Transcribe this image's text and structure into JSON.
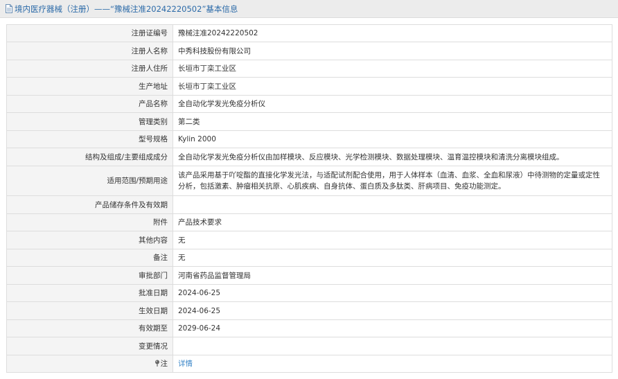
{
  "header": {
    "title": "境内医疗器械（注册）——“豫械注准20242220502”基本信息",
    "icon": "document-icon"
  },
  "rows": [
    {
      "key": "reg-number",
      "label": "注册证编号",
      "value": "豫械注准20242220502"
    },
    {
      "key": "registrant-name",
      "label": "注册人名称",
      "value": "中秀科技股份有限公司"
    },
    {
      "key": "registrant-address",
      "label": "注册人住所",
      "value": "长垣市丁栾工业区"
    },
    {
      "key": "production-address",
      "label": "生产地址",
      "value": "长垣市丁栾工业区"
    },
    {
      "key": "product-name",
      "label": "产品名称",
      "value": "全自动化学发光免疫分析仪"
    },
    {
      "key": "management-class",
      "label": "管理类别",
      "value": "第二类"
    },
    {
      "key": "model-spec",
      "label": "型号规格",
      "value": "Kylin 2000"
    },
    {
      "key": "structure-composition",
      "label": "结构及组成/主要组成成分",
      "value": "全自动化学发光免疫分析仪由加样模块、反应模块、光学检测模块、数据处理模块、温育温控模块和清洗分离模块组成。"
    },
    {
      "key": "intended-use",
      "label": "适用范围/预期用途",
      "value": "该产品采用基于吖啶酯的直接化学发光法，与适配试剂配合使用，用于人体样本（血清、血浆、全血和尿液）中待测物的定量或定性分析，包括激素、肿瘤相关抗原、心肌疾病、自身抗体、蛋白质及多肽类、肝病项目、免疫功能测定。"
    },
    {
      "key": "storage-conditions",
      "label": "产品储存条件及有效期",
      "value": ""
    },
    {
      "key": "attachment",
      "label": "附件",
      "value": "产品技术要求"
    },
    {
      "key": "other-content",
      "label": "其他内容",
      "value": "无"
    },
    {
      "key": "remarks",
      "label": "备注",
      "value": "无"
    },
    {
      "key": "approval-dept",
      "label": "审批部门",
      "value": "河南省药品监督管理局"
    },
    {
      "key": "approval-date",
      "label": "批准日期",
      "value": "2024-06-25"
    },
    {
      "key": "effective-date",
      "label": "生效日期",
      "value": "2024-06-25"
    },
    {
      "key": "expiry-date",
      "label": "有效期至",
      "value": "2029-06-24"
    },
    {
      "key": "change-history",
      "label": "变更情况",
      "value": ""
    }
  ],
  "note_row": {
    "label": "注",
    "icon": "pin-icon",
    "link": "详情"
  },
  "colors": {
    "title_text": "#2b6aa8",
    "title_bg": "#ececec",
    "label_bg": "#f4f4f4",
    "border": "#dddddd",
    "link": "#3a86c8"
  }
}
